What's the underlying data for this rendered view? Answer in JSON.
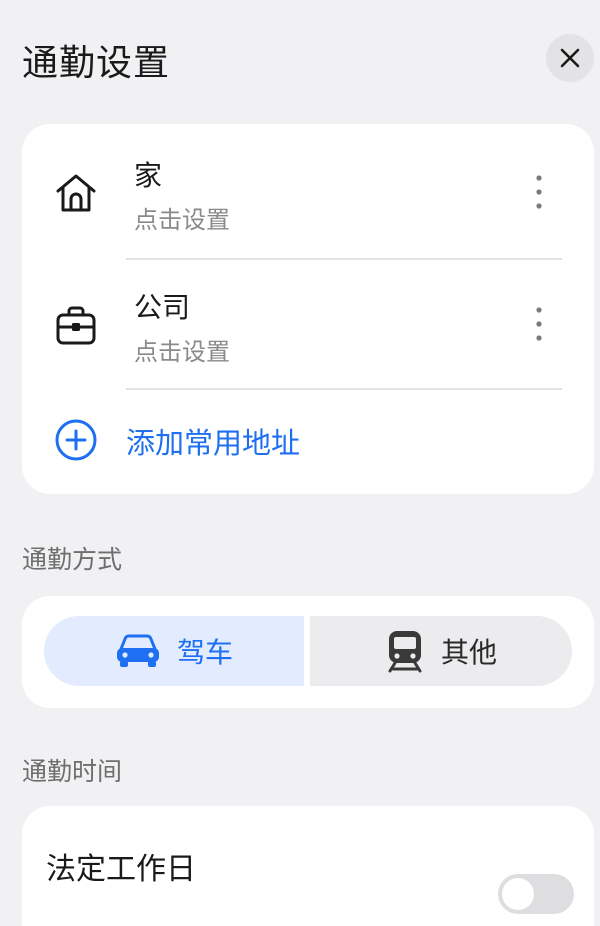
{
  "header": {
    "title": "通勤设置",
    "close_icon": "close-icon"
  },
  "addresses": [
    {
      "name": "家",
      "subtitle": "点击设置",
      "icon": "home-icon"
    },
    {
      "name": "公司",
      "subtitle": "点击设置",
      "icon": "briefcase-icon"
    }
  ],
  "add_address": {
    "label": "添加常用地址",
    "icon": "add-circle-icon"
  },
  "commute_mode": {
    "label": "通勤方式",
    "options": [
      {
        "label": "驾车",
        "icon": "car-icon",
        "selected": true
      },
      {
        "label": "其他",
        "icon": "train-icon",
        "selected": false
      }
    ]
  },
  "commute_time": {
    "label": "通勤时间",
    "item_title": "法定工作日",
    "toggle_on": false
  },
  "colors": {
    "accent": "#1f6ff2",
    "background": "#f1f1f3",
    "card": "#ffffff",
    "selected_bg": "#e3ecfe"
  }
}
